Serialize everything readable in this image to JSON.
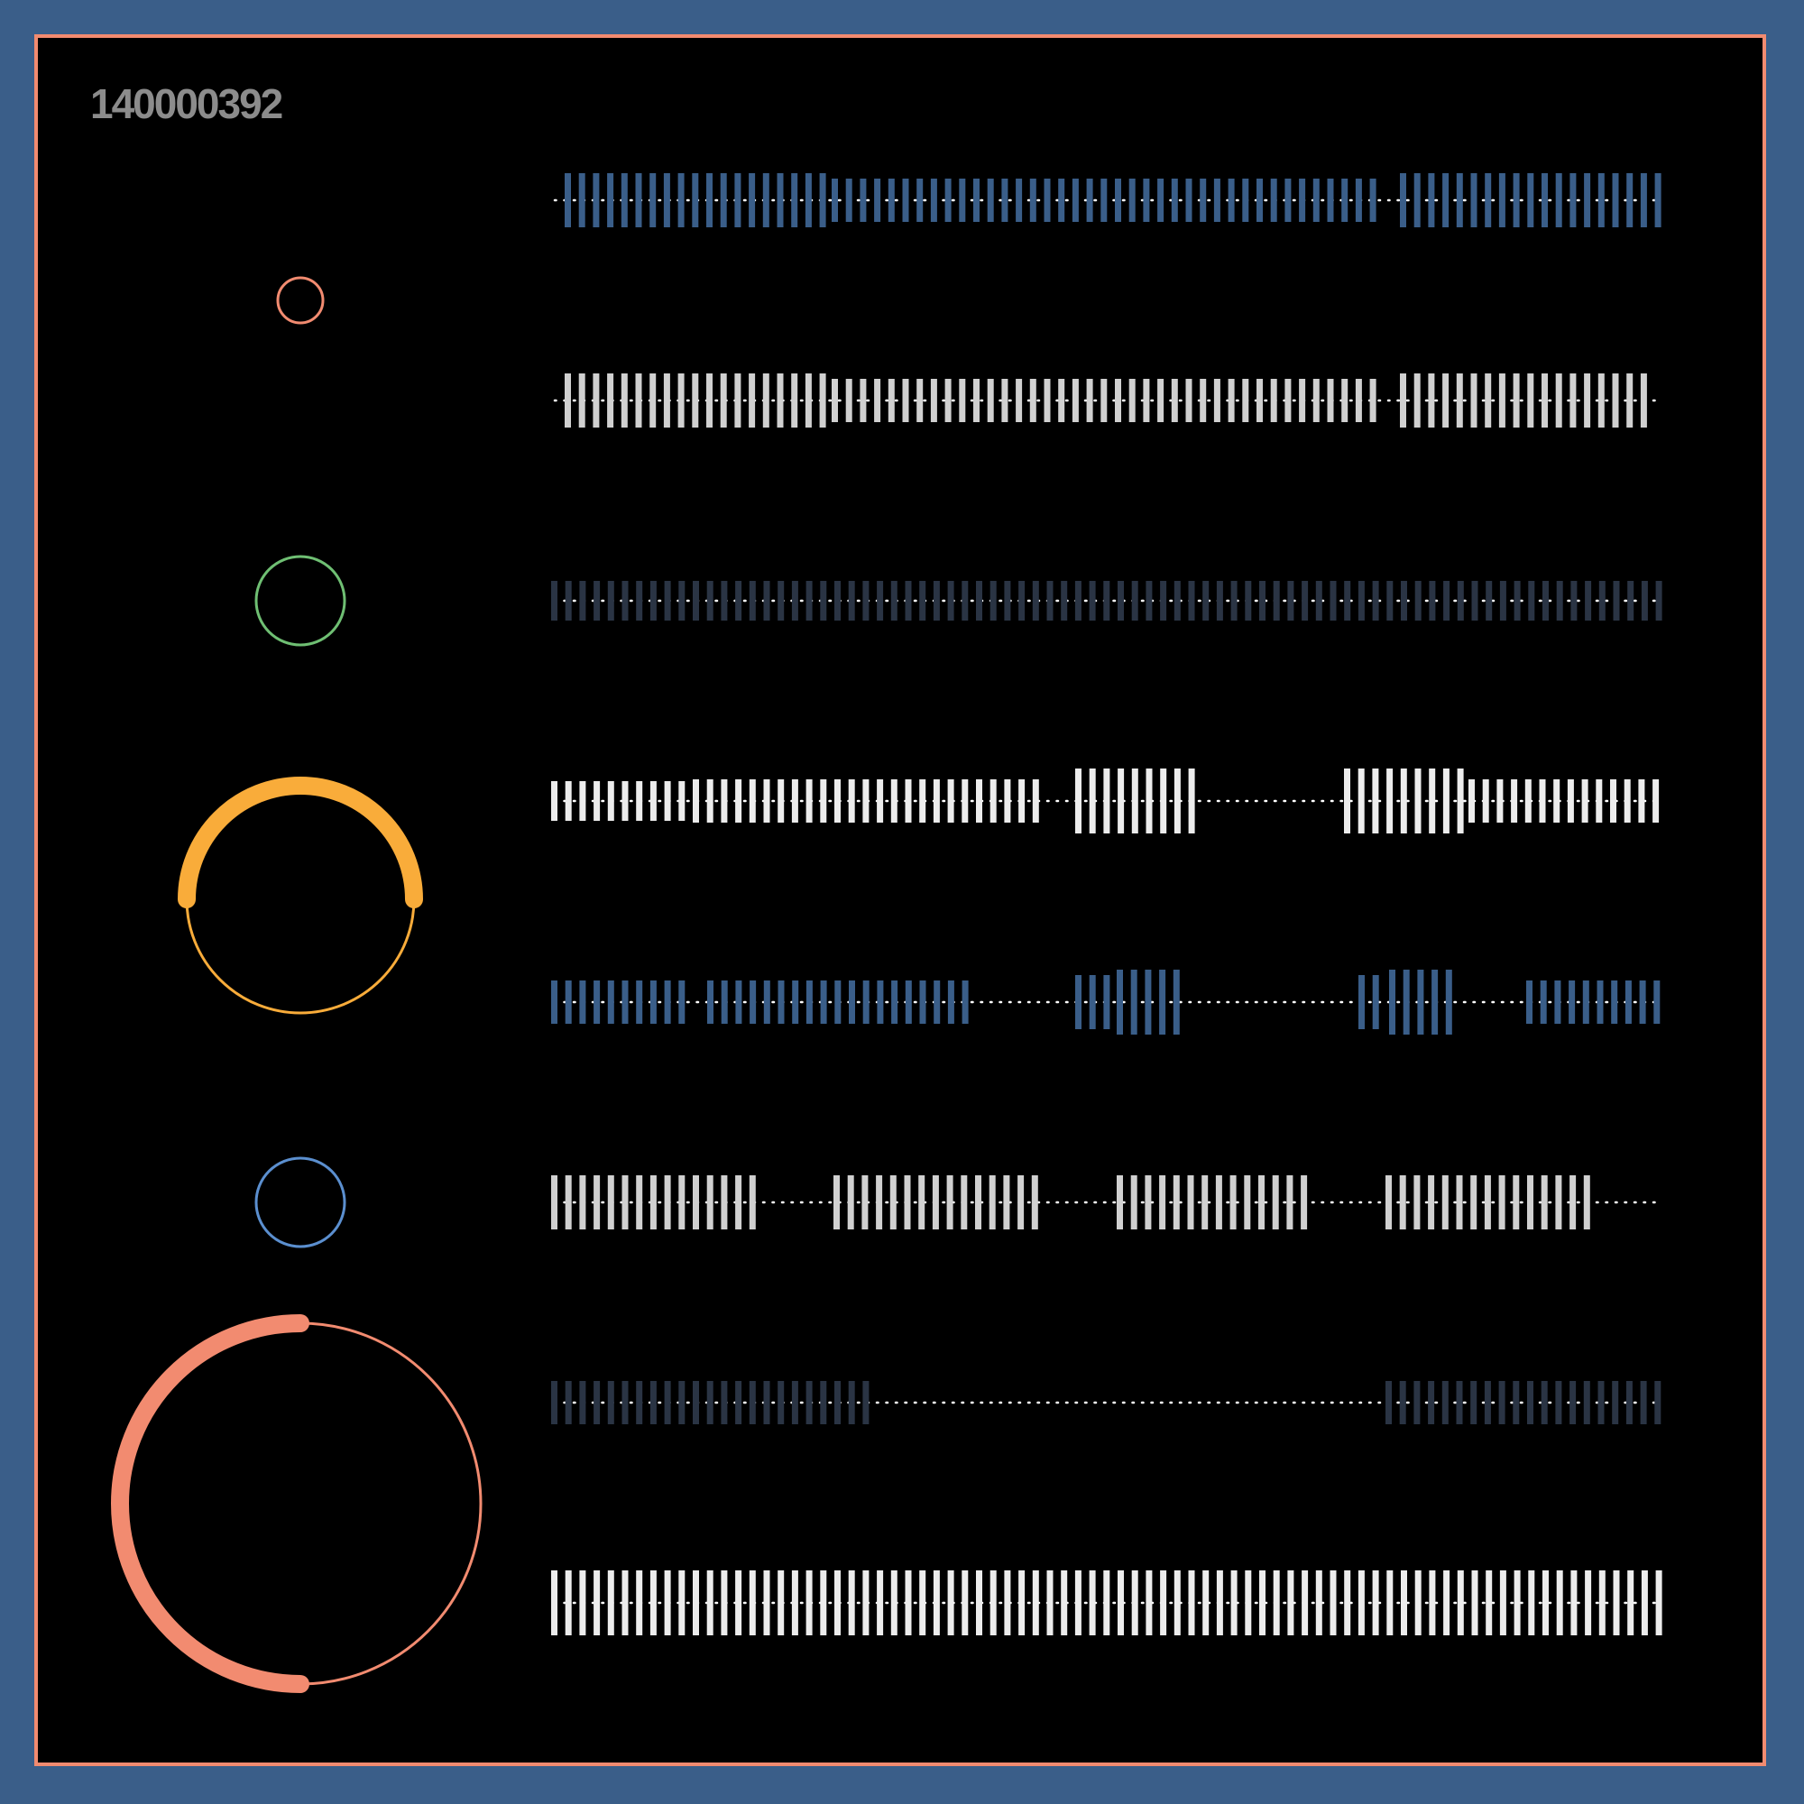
{
  "id_label": "140000392",
  "colors": {
    "background": "#3a5e89",
    "frame_border": "#f28b70",
    "canvas": "#000000",
    "label": "#8c8c8c",
    "dots": "#ffffff"
  },
  "circles": [
    {
      "name": "small-salmon-circle",
      "color": "#f28b70",
      "progress": 0
    },
    {
      "name": "green-circle",
      "color": "#6fbf73",
      "progress": 0
    },
    {
      "name": "orange-arc-gauge",
      "color": "#f9ac3a",
      "progress": 0.5
    },
    {
      "name": "blue-circle",
      "color": "#5b8fcf",
      "progress": 0
    },
    {
      "name": "salmon-arc-gauge",
      "color": "#f28b70",
      "progress": 0.5
    }
  ],
  "tracks": [
    {
      "name": "track-1",
      "color": "#3a5e89"
    },
    {
      "name": "track-2",
      "color": "#d0d0d0"
    },
    {
      "name": "track-3",
      "color": "#2a3444"
    },
    {
      "name": "track-4",
      "color": "#ececec"
    },
    {
      "name": "track-5",
      "color": "#3a5e89"
    },
    {
      "name": "track-6",
      "color": "#d0d0d0"
    },
    {
      "name": "track-7",
      "color": "#2a3444"
    },
    {
      "name": "track-8",
      "color": "#ececec"
    }
  ]
}
